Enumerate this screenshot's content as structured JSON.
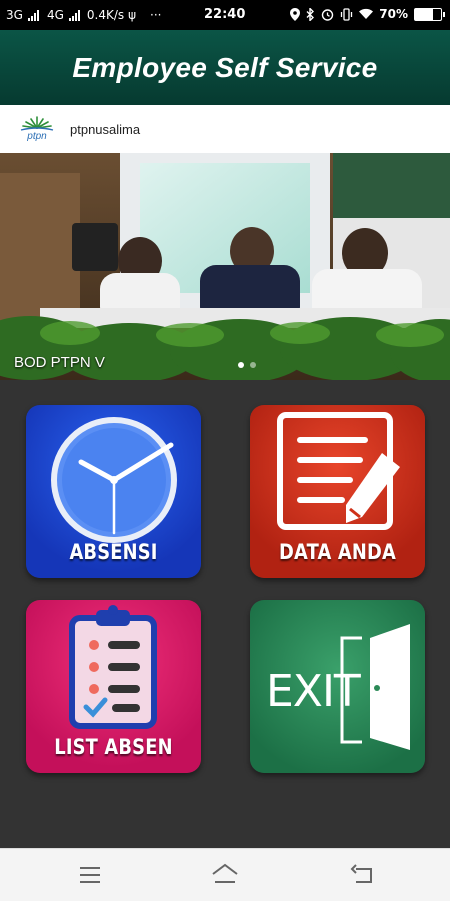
{
  "status_bar": {
    "network_1": "3G",
    "network_2": "4G",
    "speed": "0.4K/s",
    "more": "···",
    "time": "22:40",
    "battery_percent": "70%",
    "battery_level": 0.7
  },
  "app": {
    "title": "Employee Self Service"
  },
  "brand": {
    "logo_text": "ptpn",
    "name": "ptpnusalima"
  },
  "banner": {
    "caption": "BOD PTPN V",
    "page_count": 2,
    "active_page": 1
  },
  "menu": {
    "absensi": {
      "label": "ABSENSI",
      "icon": "clock-icon",
      "color": "#1e4ad8"
    },
    "data_anda": {
      "label": "DATA ANDA",
      "icon": "document-edit-icon",
      "color": "#cf3119"
    },
    "list_absen": {
      "label": "LIST ABSEN",
      "icon": "clipboard-checklist-icon",
      "color": "#e01d6a"
    },
    "exit": {
      "label": "EXIT",
      "icon": "door-exit-icon",
      "color": "#2b8a57"
    }
  },
  "navbar": {
    "items": [
      "menu-icon",
      "home-icon",
      "back-icon"
    ]
  }
}
